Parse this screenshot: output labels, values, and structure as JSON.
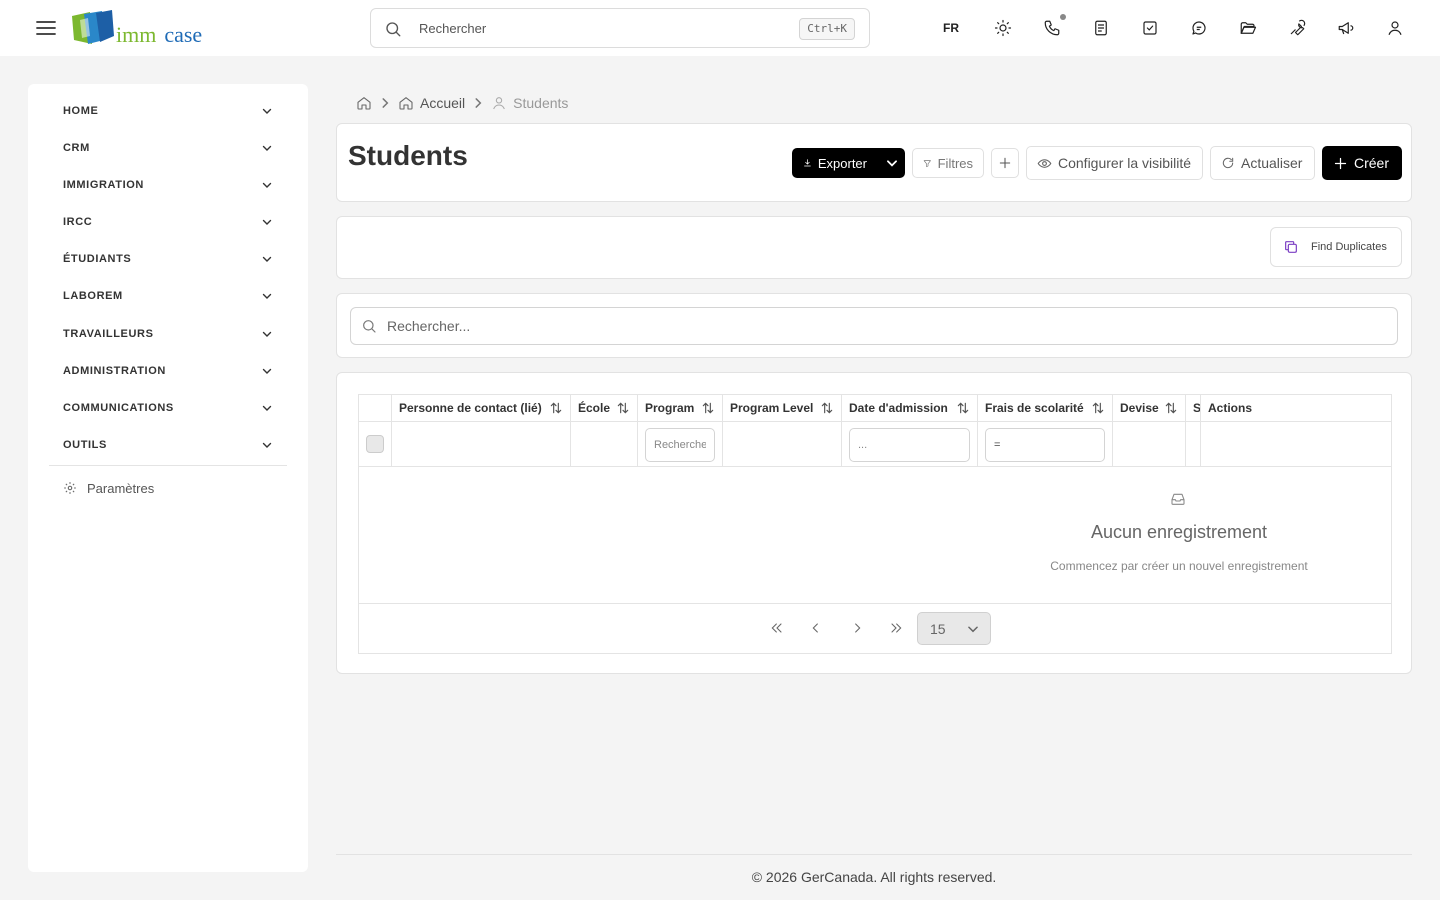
{
  "header": {
    "logo": {
      "word1": "imm",
      "word2": "case"
    },
    "search": {
      "placeholder": "Rechercher",
      "shortcut": "Ctrl+K"
    },
    "language": "FR",
    "icons": [
      "sun-icon",
      "phone-icon",
      "notes-icon",
      "tasks-icon",
      "messages-icon",
      "folder-icon",
      "tools-icon",
      "megaphone-icon",
      "user-icon"
    ]
  },
  "sidebar": {
    "items": [
      {
        "label": "HOME"
      },
      {
        "label": "CRM"
      },
      {
        "label": "IMMIGRATION"
      },
      {
        "label": "IRCC"
      },
      {
        "label": "ÉTUDIANTS"
      },
      {
        "label": "LABOREM"
      },
      {
        "label": "TRAVAILLEURS"
      },
      {
        "label": "ADMINISTRATION"
      },
      {
        "label": "COMMUNICATIONS"
      },
      {
        "label": "OUTILS"
      }
    ],
    "settings_label": "Paramètres"
  },
  "breadcrumb": {
    "home": "Accueil",
    "current": "Students"
  },
  "page": {
    "title": "Students",
    "actions": {
      "export": "Exporter",
      "filters": "Filtres",
      "visibility": "Configurer la visibilité",
      "refresh": "Actualiser",
      "create": "Créer"
    },
    "find_duplicates": "Find Duplicates",
    "search_placeholder": "Rechercher..."
  },
  "table": {
    "columns": [
      {
        "label": "Personne de contact (lié)"
      },
      {
        "label": "École"
      },
      {
        "label": "Program"
      },
      {
        "label": "Program Level"
      },
      {
        "label": "Date d'admission"
      },
      {
        "label": "Frais de scolarité"
      },
      {
        "label": "Devise"
      },
      {
        "label": "S"
      },
      {
        "label": "Actions"
      }
    ],
    "filters": {
      "program_placeholder": "Recherche",
      "date_placeholder": "...",
      "fees_value": "="
    },
    "empty": {
      "title": "Aucun enregistrement",
      "subtitle": "Commencez par créer un nouvel enregistrement"
    },
    "page_size": "15"
  },
  "footer": "© 2026 GerCanada. All rights reserved."
}
